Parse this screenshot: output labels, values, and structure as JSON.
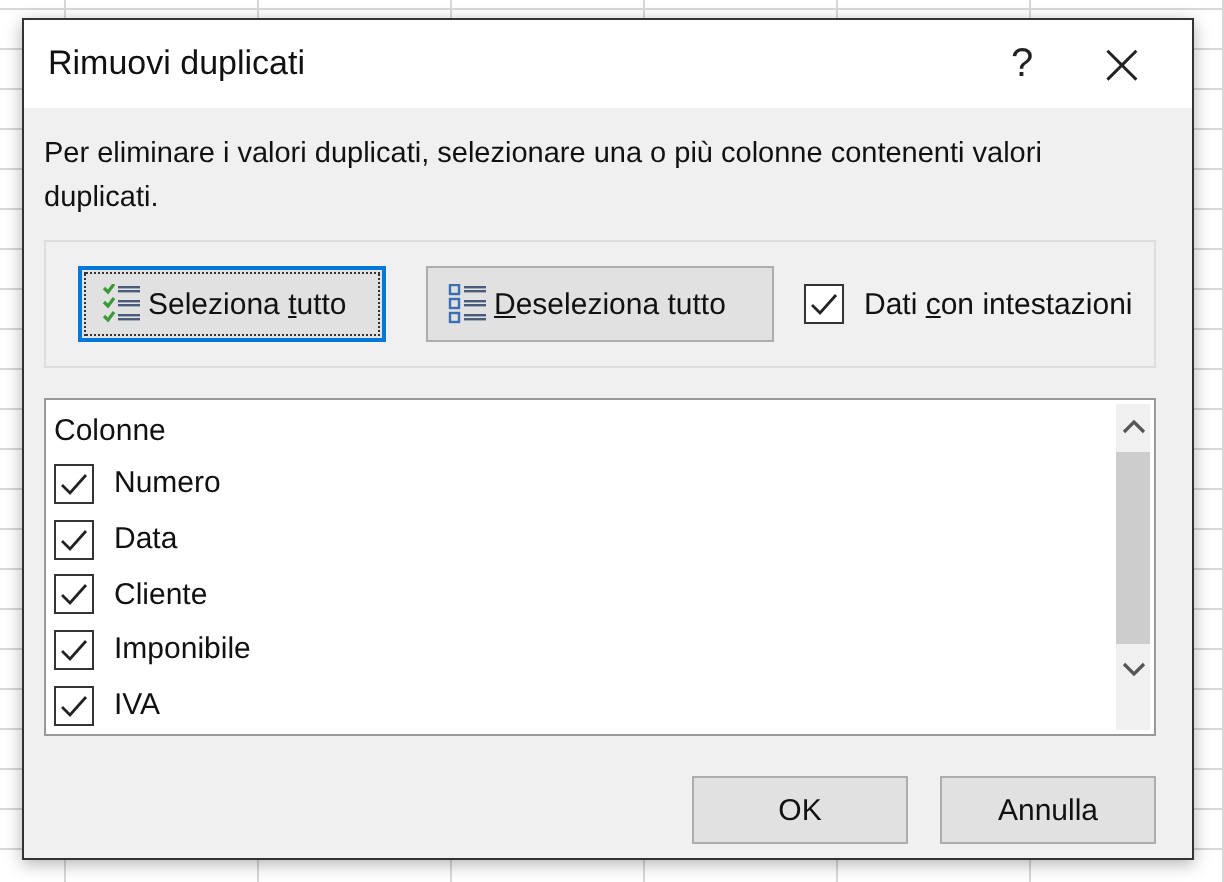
{
  "window": {
    "title": "Rimuovi duplicati",
    "help": "?",
    "close": "×"
  },
  "description": "Per eliminare i valori duplicati, selezionare una o più colonne contenenti valori duplicati.",
  "toolbar": {
    "buttons": [
      {
        "kind": "select_all",
        "label_before": "Seleziona ",
        "access_key": "t",
        "label_after": "utto",
        "focused": true
      },
      {
        "kind": "deselect_all",
        "access_key": "D",
        "label_after": "eseleziona tutto",
        "focused": false
      }
    ],
    "headers_checkbox": {
      "label_before": "Dati ",
      "access_key": "c",
      "label_after": "on intestazioni",
      "checked": true
    }
  },
  "list": {
    "header": "Colonne",
    "items": [
      {
        "label": "Numero",
        "checked": true
      },
      {
        "label": "Data",
        "checked": true
      },
      {
        "label": "Cliente",
        "checked": true
      },
      {
        "label": "Imponibile",
        "checked": true
      },
      {
        "label": "IVA",
        "checked": true
      }
    ]
  },
  "buttons": [
    "OK",
    "Annulla"
  ]
}
